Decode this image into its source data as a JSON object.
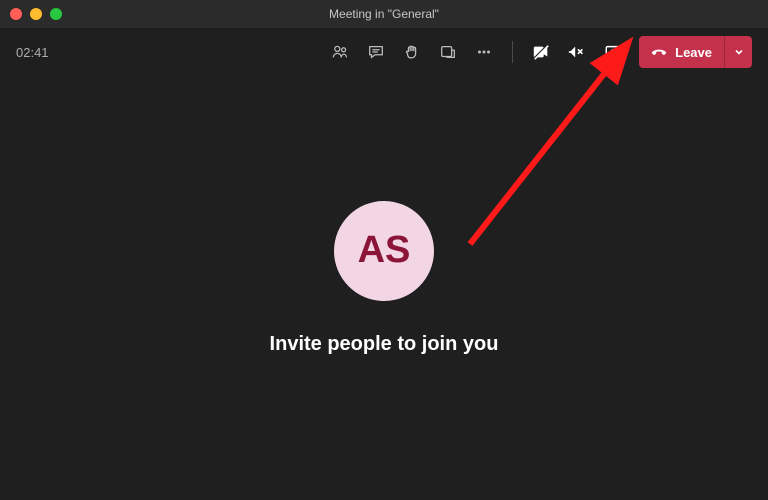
{
  "window": {
    "title": "Meeting in \"General\""
  },
  "toolbar": {
    "timer": "02:41",
    "leave_label": "Leave"
  },
  "avatar": {
    "initials": "AS"
  },
  "main": {
    "invite_text": "Invite people to join you"
  },
  "icons": {
    "people": "people-icon",
    "chat": "chat-icon",
    "raise_hand": "raise-hand-icon",
    "rooms": "rooms-icon",
    "more": "more-icon",
    "camera_off": "camera-off-icon",
    "mic_off": "mic-off-icon",
    "share": "share-screen-icon",
    "hangup": "hangup-icon",
    "chevron": "chevron-down-icon"
  },
  "colors": {
    "leave_bg": "#c4314b",
    "avatar_bg": "#f3d6e4",
    "avatar_fg": "#8b1538"
  }
}
